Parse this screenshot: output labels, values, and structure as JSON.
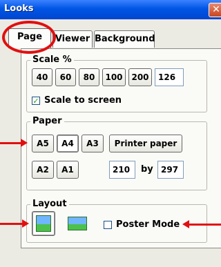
{
  "window": {
    "title": "Looks"
  },
  "tabs": [
    {
      "label": "Page",
      "selected": true
    },
    {
      "label": "Viewer",
      "selected": false
    },
    {
      "label": "Background",
      "selected": false
    }
  ],
  "scale": {
    "label": "Scale %",
    "presets": [
      "40",
      "60",
      "80",
      "100",
      "200"
    ],
    "value": "126",
    "scale_to_screen": {
      "label": "Scale to screen",
      "checked": true
    }
  },
  "paper": {
    "label": "Paper",
    "sizes_row1": [
      "A5",
      "A4",
      "A3"
    ],
    "sizes_row2": [
      "A2",
      "A1"
    ],
    "selected": "A4",
    "printer_paper_label": "Printer paper",
    "width": "210",
    "by_label": "by",
    "height": "297"
  },
  "layout": {
    "label": "Layout",
    "poster_mode": {
      "label": "Poster Mode",
      "checked": false
    }
  },
  "colors": {
    "highlight": "#e01010",
    "titlebar": "#0055e5"
  }
}
